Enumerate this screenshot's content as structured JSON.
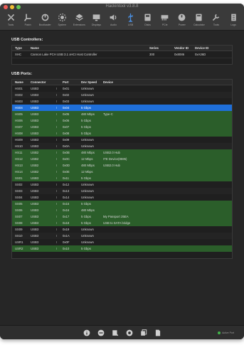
{
  "window": {
    "title": "Hackintool v3.8.8"
  },
  "toolbar": [
    {
      "label": "Tools",
      "icon": "tools-icon"
    },
    {
      "label": "Patch",
      "icon": "patch-icon"
    },
    {
      "label": "Bootloader",
      "icon": "bootloader-icon"
    },
    {
      "label": "System",
      "icon": "system-icon"
    },
    {
      "label": "Extensions",
      "icon": "extensions-icon"
    },
    {
      "label": "Displays",
      "icon": "displays-icon"
    },
    {
      "label": "Audio",
      "icon": "audio-icon"
    },
    {
      "label": "USB",
      "icon": "usb-icon",
      "active": true
    },
    {
      "label": "Disks",
      "icon": "disks-icon"
    },
    {
      "label": "PCIe",
      "icon": "pcie-icon"
    },
    {
      "label": "Power",
      "icon": "power-icon"
    },
    {
      "label": "Calculator",
      "icon": "calculator-icon"
    },
    {
      "label": "Tools",
      "icon": "wrench-icon"
    },
    {
      "label": "Logs",
      "icon": "logs-icon"
    }
  ],
  "controllers": {
    "title": "USB Controllers:",
    "headers": {
      "type": "Type",
      "name": "Name",
      "series": "Series",
      "vendor": "Vendor ID",
      "device": "Device ID"
    },
    "rows": [
      {
        "type": "XHC",
        "name": "Cannon Lake PCH USB 3.1 xHCI Host Controller",
        "series": "300",
        "vendor": "0x8086",
        "device": "0xA36D"
      }
    ]
  },
  "ports": {
    "title": "USB Ports:",
    "headers": {
      "name": "Name",
      "connector": "Connector",
      "port": "Port",
      "speed": "Dev Speed",
      "device": "Device"
    },
    "rows": [
      {
        "name": "HS01",
        "connector": "USB3",
        "port": "0x01",
        "speed": "Unknown",
        "device": "",
        "style": "plain"
      },
      {
        "name": "HS02",
        "connector": "USB3",
        "port": "0x02",
        "speed": "Unknown",
        "device": "",
        "style": "stripe"
      },
      {
        "name": "HS03",
        "connector": "USB3",
        "port": "0x03",
        "speed": "Unknown",
        "device": "",
        "style": "plain"
      },
      {
        "name": "HS04",
        "connector": "USB3",
        "port": "0x04",
        "speed": "5 Gbps",
        "device": "",
        "style": "blue"
      },
      {
        "name": "HS05",
        "connector": "USB3",
        "port": "0x05",
        "speed": "480 Mbps",
        "device": "Type-C",
        "style": "green"
      },
      {
        "name": "HS06",
        "connector": "USB3",
        "port": "0x06",
        "speed": "5 Gbps",
        "device": "",
        "style": "green"
      },
      {
        "name": "HS07",
        "connector": "USB3",
        "port": "0x07",
        "speed": "5 Gbps",
        "device": "",
        "style": "green"
      },
      {
        "name": "HS08",
        "connector": "USB3",
        "port": "0x08",
        "speed": "5 Gbps",
        "device": "",
        "style": "green"
      },
      {
        "name": "HS09",
        "connector": "USB3",
        "port": "0x09",
        "speed": "Unknown",
        "device": "",
        "style": "plain"
      },
      {
        "name": "HS10",
        "connector": "USB3",
        "port": "0x0A",
        "speed": "Unknown",
        "device": "",
        "style": "stripe"
      },
      {
        "name": "HS11",
        "connector": "USB2",
        "port": "0x0B",
        "speed": "480 Mbps",
        "device": "USB2.0 Hub",
        "style": "green"
      },
      {
        "name": "HS12",
        "connector": "USB2",
        "port": "0x0C",
        "speed": "12 Mbps",
        "device": "ITE Device(8595)",
        "style": "green"
      },
      {
        "name": "HS13",
        "connector": "USB2",
        "port": "0x0D",
        "speed": "480 Mbps",
        "device": "USB2.0 Hub",
        "style": "green"
      },
      {
        "name": "HS14",
        "connector": "USB2",
        "port": "0x0E",
        "speed": "12 Mbps",
        "device": "",
        "style": "green"
      },
      {
        "name": "SS01",
        "connector": "USB3",
        "port": "0x11",
        "speed": "5 Gbps",
        "device": "",
        "style": "green"
      },
      {
        "name": "SS02",
        "connector": "USB3",
        "port": "0x12",
        "speed": "Unknown",
        "device": "",
        "style": "plain"
      },
      {
        "name": "SS03",
        "connector": "USB3",
        "port": "0x13",
        "speed": "Unknown",
        "device": "",
        "style": "stripe"
      },
      {
        "name": "SS04",
        "connector": "USB3",
        "port": "0x14",
        "speed": "Unknown",
        "device": "",
        "style": "plain"
      },
      {
        "name": "SS05",
        "connector": "USB3",
        "port": "0x15",
        "speed": "5 Gbps",
        "device": "",
        "style": "green"
      },
      {
        "name": "SS06",
        "connector": "USB3",
        "port": "0x16",
        "speed": "480 Mbps",
        "device": "",
        "style": "green"
      },
      {
        "name": "SS07",
        "connector": "USB3",
        "port": "0x17",
        "speed": "5 Gbps",
        "device": "My Passport 25EA",
        "style": "green"
      },
      {
        "name": "SS08",
        "connector": "USB3",
        "port": "0x18",
        "speed": "5 Gbps",
        "device": "USB to SATA bridge",
        "style": "green"
      },
      {
        "name": "SS09",
        "connector": "USB3",
        "port": "0x19",
        "speed": "Unknown",
        "device": "",
        "style": "plain"
      },
      {
        "name": "SS10",
        "connector": "USB3",
        "port": "0x1A",
        "speed": "Unknown",
        "device": "",
        "style": "stripe"
      },
      {
        "name": "USR1",
        "connector": "USB3",
        "port": "0x0F",
        "speed": "Unknown",
        "device": "",
        "style": "plain"
      },
      {
        "name": "USR2",
        "connector": "USB3",
        "port": "0x10",
        "speed": "5 Gbps",
        "device": "",
        "style": "green"
      }
    ]
  },
  "bottombar": {
    "icons": [
      "info-icon",
      "remove-icon",
      "export-icon",
      "refresh-icon",
      "copy-icon",
      "file-icon"
    ],
    "status": "Active Port"
  },
  "colors": {
    "accent": "#1f6fd9",
    "active_row": "#2b5e2a",
    "window": "#262626",
    "toolbar": "#3a3a3a"
  }
}
